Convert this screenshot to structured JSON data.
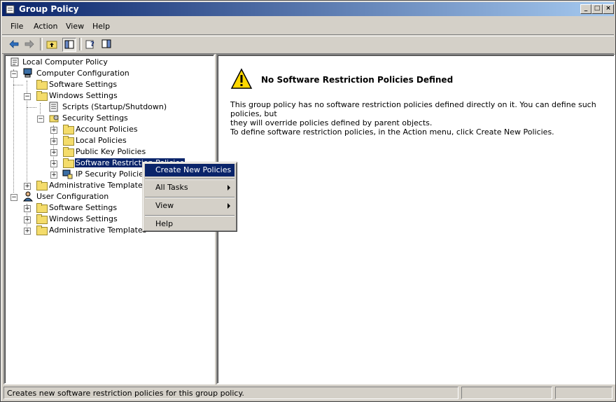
{
  "window": {
    "title": "Group Policy",
    "min": "_",
    "max": "□",
    "close": "×"
  },
  "menu": [
    "File",
    "Action",
    "View",
    "Help"
  ],
  "tree": {
    "root": "Local Computer Policy",
    "computer": "Computer Configuration",
    "cc_software": "Software Settings",
    "cc_windows": "Windows Settings",
    "scripts": "Scripts (Startup/Shutdown)",
    "security": "Security Settings",
    "account": "Account Policies",
    "local": "Local Policies",
    "pubkey": "Public Key Policies",
    "srp": "Software Restriction Policies",
    "ipsec": "IP Security Policies on Local Computer",
    "cc_admin": "Administrative Templates",
    "user": "User Configuration",
    "uc_software": "Software Settings",
    "uc_windows": "Windows Settings",
    "uc_admin": "Administrative Templates"
  },
  "context_menu": {
    "create": "Create New Policies",
    "all_tasks": "All Tasks",
    "view": "View",
    "help": "Help"
  },
  "result": {
    "heading": "No Software Restriction Policies Defined",
    "para1_line1": "This group policy has no software restriction policies defined directly on it. You can define such policies, but",
    "para1_line2": "they will override policies defined by parent objects.",
    "para2": "To define software restriction policies, in the Action menu, click Create New Policies."
  },
  "status": {
    "text": "Creates new software restriction policies for this group policy."
  },
  "colors": {
    "selection": "#0a246a",
    "face": "#d4d0c8",
    "warning": "#ffd800"
  }
}
